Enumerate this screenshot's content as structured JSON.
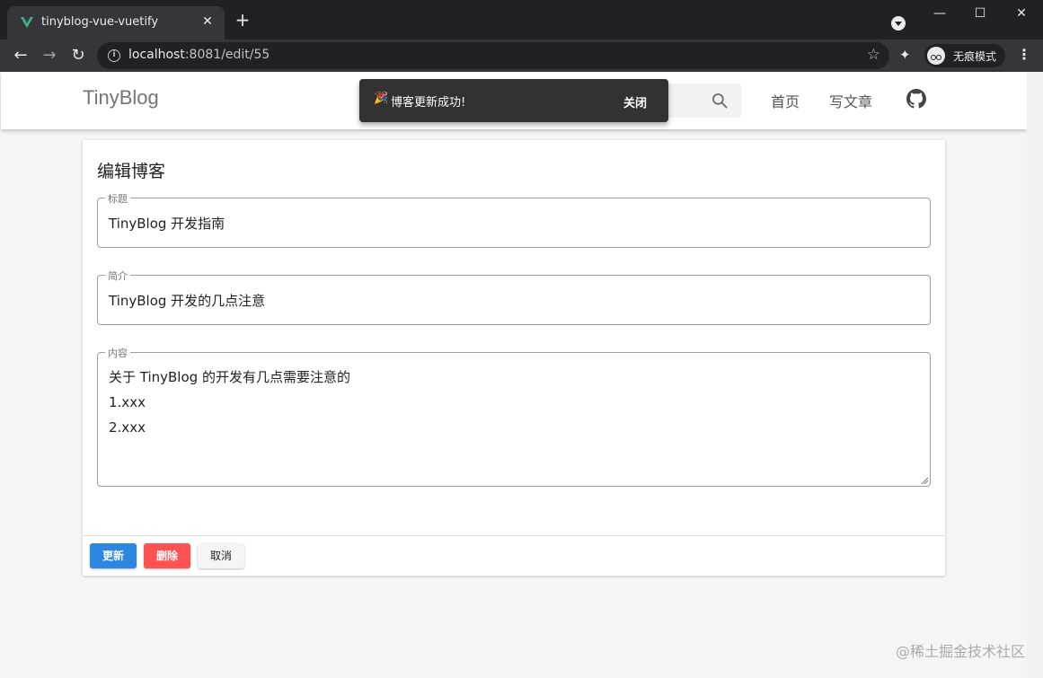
{
  "browser": {
    "tab_title": "tinyblog-vue-vuetify",
    "tab_close": "✕",
    "new_tab": "+",
    "url_host": "localhost",
    "url_rest": ":8081/edit/55",
    "incognito_label": "无痕模式",
    "win_minimize": "—",
    "win_maximize": "☐",
    "win_close": "✕",
    "back": "←",
    "forward": "→",
    "reload": "↻",
    "star": "☆",
    "extensions": "✦",
    "menu": "⋮"
  },
  "appbar": {
    "brand": "TinyBlog",
    "nav_home": "首页",
    "nav_write": "写文章"
  },
  "snackbar": {
    "emoji": "🎉",
    "message": "博客更新成功!",
    "close_label": "关闭"
  },
  "editor": {
    "heading": "编辑博客",
    "title_legend": "标题",
    "title_value": "TinyBlog 开发指南",
    "summary_legend": "简介",
    "summary_value": "TinyBlog 开发的几点注意",
    "content_legend": "内容",
    "content_lines": [
      "关于 TinyBlog 的开发有几点需要注意的",
      "1.xxx",
      "2.xxx"
    ],
    "update_label": "更新",
    "delete_label": "删除",
    "cancel_label": "取消"
  },
  "watermark": "@稀土掘金技术社区",
  "colors": {
    "primary": "#2c87e0",
    "danger": "#ff5252",
    "snackbar_bg": "#323232"
  }
}
